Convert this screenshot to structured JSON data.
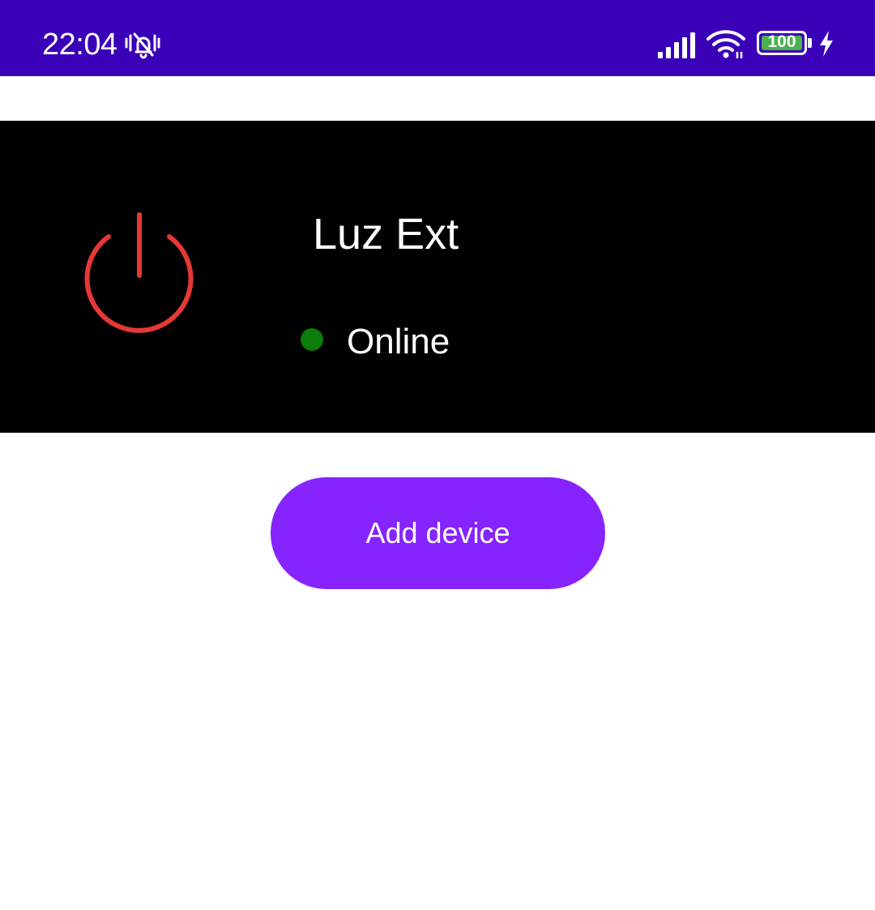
{
  "status_bar": {
    "time": "22:04",
    "battery_level": "100",
    "icons": [
      "bell-off-vibrate-icon",
      "signal-icon",
      "wifi-icon",
      "battery-icon",
      "charging-bolt-icon"
    ],
    "background_color": "#3a00b8"
  },
  "device": {
    "name": "Luz Ext",
    "status": "Online",
    "status_color": "#0a7d0a",
    "power_icon": "power-icon",
    "power_color": "#e53935"
  },
  "actions": {
    "add_device_label": "Add device",
    "add_device_color": "#8624ff"
  }
}
